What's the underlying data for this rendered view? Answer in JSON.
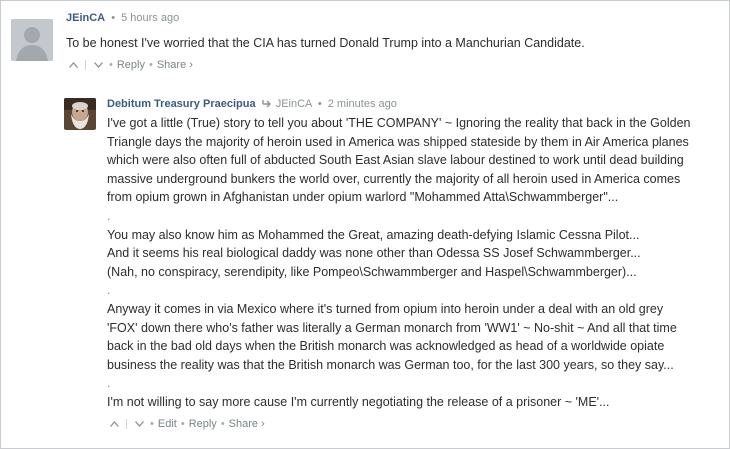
{
  "comments": [
    {
      "author": "JEinCA",
      "time": "5 hours ago",
      "lines": [
        "To be honest I've worried that the CIA has turned Donald Trump into a Manchurian Candidate."
      ],
      "actions": {
        "reply": "Reply",
        "share": "Share ›"
      }
    },
    {
      "author": "Debitum Treasury Praecipua",
      "reply_to": "JEinCA",
      "time": "2 minutes ago",
      "lines": [
        "I've got a little (True) story to tell you about 'THE COMPANY' ~ Ignoring the reality that back in the Golden",
        "Triangle days the majority of heroin used in America was shipped stateside by them in Air America planes",
        "which were also often full of abducted South East Asian slave labour destined to work until dead building",
        "massive underground bunkers the world over, currently the majority of all heroin used in America comes",
        "from opium grown in Afghanistan under opium warlord \"Mohammed Atta\\Schwammberger\"...",
        ".",
        "You may also know him as Mohammed the Great, amazing death-defying Islamic Cessna Pilot...",
        "And it seems his real biological daddy was none other than Odessa SS Josef Schwammberger...",
        "(Nah, no conspiracy, serendipity, like Pompeo\\Schwammberger and Haspel\\Schwammberger)...",
        ".",
        "Anyway it comes in via Mexico where it's turned from opium into heroin under a deal with an old grey",
        "'FOX' down there who's father was literally a German monarch from 'WW1' ~ No-shit ~ And all that time",
        "back in the bad old days when the British monarch was acknowledged as head of a worldwide opiate",
        "business the reality was that the British monarch was German too, for the last 300 years, so they say...",
        ".",
        "I'm not willing to say more cause I'm currently negotiating the release of a prisoner ~ 'ME'..."
      ],
      "actions": {
        "edit": "Edit",
        "reply": "Reply",
        "share": "Share ›"
      }
    }
  ],
  "bullet": "•"
}
